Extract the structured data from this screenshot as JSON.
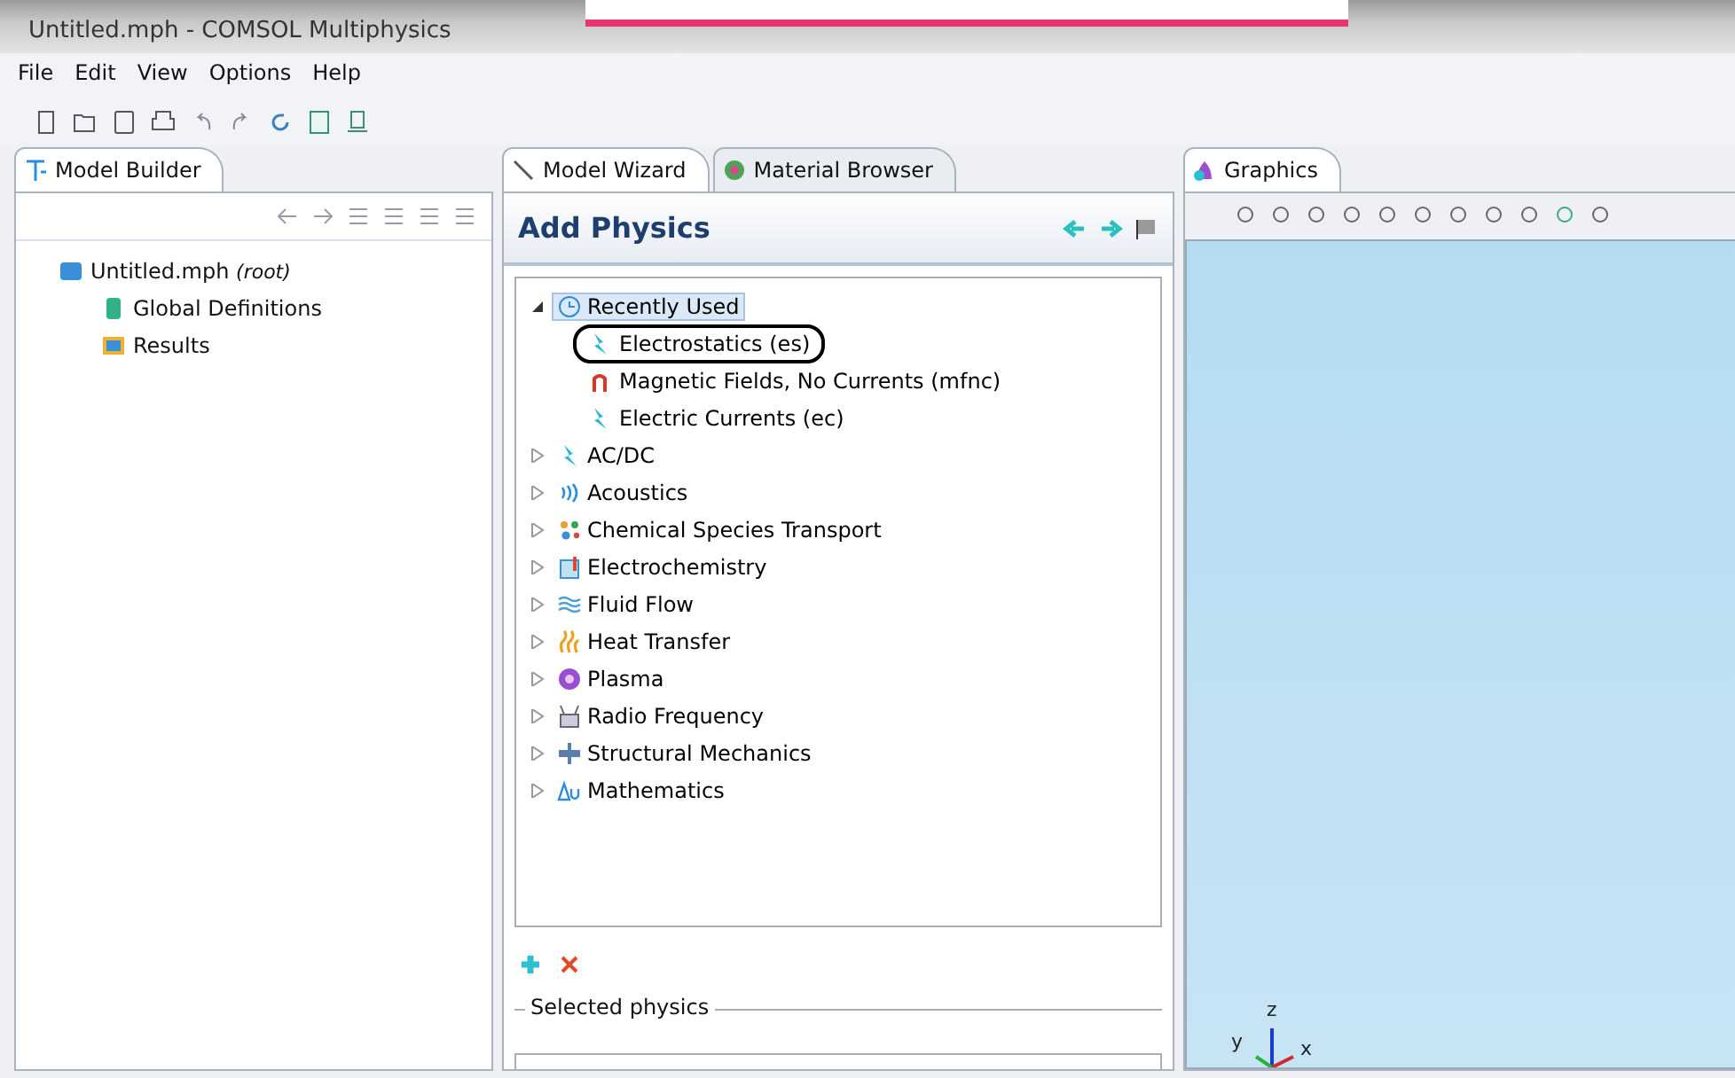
{
  "window": {
    "title": "Untitled.mph - COMSOL Multiphysics"
  },
  "menu": [
    "File",
    "Edit",
    "View",
    "Options",
    "Help"
  ],
  "model_builder": {
    "tab": "Model Builder",
    "tree": [
      {
        "label": "Untitled.mph",
        "note": "(root)",
        "children": [
          {
            "label": "Global Definitions"
          },
          {
            "label": "Results"
          }
        ]
      }
    ]
  },
  "wizard": {
    "tabs": [
      {
        "label": "Model Wizard",
        "selected": true
      },
      {
        "label": "Material Browser",
        "selected": false
      }
    ],
    "heading": "Add Physics",
    "tree": [
      {
        "label": "Recently Used",
        "expanded": true,
        "selected": true,
        "children": [
          {
            "label": "Electrostatics (es)",
            "circled": true
          },
          {
            "label": "Magnetic Fields, No Currents (mfnc)",
            "circled": false
          },
          {
            "label": "Electric Currents (ec)",
            "circled": false
          }
        ]
      },
      {
        "label": "AC/DC",
        "expanded": false,
        "selected": false
      },
      {
        "label": "Acoustics",
        "expanded": false,
        "selected": false
      },
      {
        "label": "Chemical Species Transport",
        "expanded": false,
        "selected": false
      },
      {
        "label": "Electrochemistry",
        "expanded": false,
        "selected": false
      },
      {
        "label": "Fluid Flow",
        "expanded": false,
        "selected": false
      },
      {
        "label": "Heat Transfer",
        "expanded": false,
        "selected": false
      },
      {
        "label": "Plasma",
        "expanded": false,
        "selected": false
      },
      {
        "label": "Radio Frequency",
        "expanded": false,
        "selected": false
      },
      {
        "label": "Structural Mechanics",
        "expanded": false,
        "selected": false
      },
      {
        "label": "Mathematics",
        "expanded": false,
        "selected": false
      }
    ],
    "selected_group": "Selected physics"
  },
  "graphics": {
    "tab": "Graphics",
    "axes": [
      "z",
      "y",
      "x"
    ]
  }
}
